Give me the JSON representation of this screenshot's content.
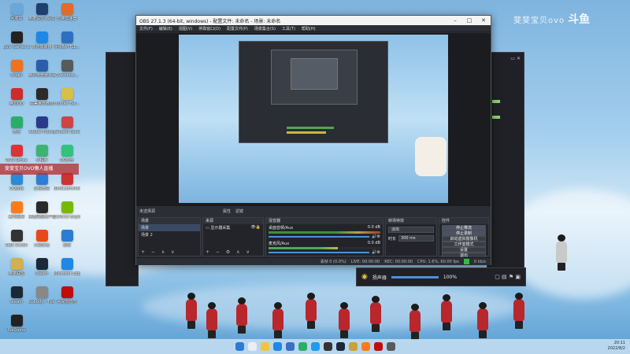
{
  "watermark": {
    "text1": "斐斐宝贝ovo",
    "text2": "斗鱼"
  },
  "live_tag": "斐斐宝贝OVO懒人直播",
  "desktop": {
    "icons": [
      {
        "label": "回收站",
        "color": "#6aa8d8"
      },
      {
        "label": "英雄联盟 WeGame版",
        "color": "#1f3f6f"
      },
      {
        "label": "雷神加速器",
        "color": "#e06b2b"
      },
      {
        "label": "Epic Games Launcher",
        "color": "#222"
      },
      {
        "label": "新增加速器",
        "color": "#1e88e5"
      },
      {
        "label": "网易BATTLE...",
        "color": "#2f6fbf"
      },
      {
        "label": "Origin",
        "color": "#f2711c"
      },
      {
        "label": "腾讯电竞赛大事件",
        "color": "#2b5dab"
      },
      {
        "label": "Overclock...",
        "color": "#5a5a5a"
      },
      {
        "label": "腾讯QQ",
        "color": "#d02b2b"
      },
      {
        "label": "完美世界竞技",
        "color": "#2a2a2a"
      },
      {
        "label": "Human Fall...",
        "color": "#d6c04a"
      },
      {
        "label": "微信",
        "color": "#2aae67"
      },
      {
        "label": "Adobe Photosho...",
        "color": "#2a3a8a"
      },
      {
        "label": "Tencent Games",
        "color": "#c44"
      },
      {
        "label": "WPS Office",
        "color": "#d33"
      },
      {
        "label": "小程序",
        "color": "#3cb371"
      },
      {
        "label": "QQ音乐",
        "color": "#31c27c"
      },
      {
        "label": "QQ游戏",
        "color": "#2b8ad8"
      },
      {
        "label": "企业微信",
        "color": "#2e7dd7"
      },
      {
        "label": "BootLauncher",
        "color": "#c33"
      },
      {
        "label": "腾讯视频",
        "color": "#ff7a1a"
      },
      {
        "label": "英雄联盟客户端",
        "color": "#2a2a2a"
      },
      {
        "label": "Geforce Experience",
        "color": "#76b900"
      },
      {
        "label": "OBS Studio",
        "color": "#333"
      },
      {
        "label": "火绒安全",
        "color": "#e64a19"
      },
      {
        "label": "迅雷",
        "color": "#2b7cd3"
      },
      {
        "label": "英雄联盟",
        "color": "#d4b04a"
      },
      {
        "label": "Steam",
        "color": "#1b2838"
      },
      {
        "label": "Microsoft Edge",
        "color": "#1e88e5"
      },
      {
        "label": "Steam",
        "color": "#1b2838"
      },
      {
        "label": "Nobody - The Turna...",
        "color": "#888"
      },
      {
        "label": "网易云音乐",
        "color": "#c20c0c"
      },
      {
        "label": "WeGame",
        "color": "#222"
      }
    ]
  },
  "obs": {
    "title": "OBS 27.1.3 (64-bit, windows) - 配置文件: 未命名 - 场景: 未命名",
    "menu": [
      "文件(F)",
      "编辑(E)",
      "视图(V)",
      "停靠窗口(D)",
      "配置文件(P)",
      "场景集合(S)",
      "工具(T)",
      "帮助(H)"
    ],
    "status_row": {
      "left": "未选择源",
      "props": "属性",
      "filters": "滤镜"
    },
    "docks": {
      "scenes": {
        "header": "场景",
        "items": [
          "场景",
          "场景 2"
        ],
        "selected": 0
      },
      "sources": {
        "header": "来源",
        "items": [
          "显示器采集"
        ]
      },
      "mixer": {
        "header": "混音器",
        "channels": [
          {
            "name": "桌面音频/Aux",
            "db": "0.0 dB"
          },
          {
            "name": "麦克风/Aux",
            "db": "0.0 dB"
          }
        ]
      },
      "transitions": {
        "header": "转场特效",
        "type": "淡出",
        "duration_label": "时长",
        "duration": "300 ms"
      },
      "controls": {
        "header": "控件",
        "buttons": [
          "停止推流",
          "停止录制",
          "启动虚拟摄像机",
          "工作室模式",
          "设置",
          "退出"
        ]
      }
    },
    "statusbar": {
      "dropped": "丢帧 0 (0.0%)",
      "live": "LIVE: 00:00:00",
      "rec": "REC: 00:00:00",
      "cpu": "CPU: 1.6%, 60.00 fps",
      "kbps": "0 kb/s",
      "status_color": "#2fbf3f"
    }
  },
  "speaker_bar": {
    "label": "扬声器",
    "volume": "100%"
  },
  "tray": {
    "time": "20:11",
    "date": "2022/8/2"
  },
  "taskbar": {
    "icons": [
      {
        "name": "windows",
        "color": "#2a7bd6"
      },
      {
        "name": "search",
        "color": "#e8eef4"
      },
      {
        "name": "explorer",
        "color": "#f5c33b"
      },
      {
        "name": "edge",
        "color": "#1e88e5"
      },
      {
        "name": "store",
        "color": "#3a6fc4"
      },
      {
        "name": "wechat",
        "color": "#2aae67"
      },
      {
        "name": "qq",
        "color": "#1e9cf0"
      },
      {
        "name": "obs",
        "color": "#333"
      },
      {
        "name": "steam",
        "color": "#1b2838"
      },
      {
        "name": "lol",
        "color": "#c9a23a"
      },
      {
        "name": "douyu",
        "color": "#ff7a1a"
      },
      {
        "name": "music",
        "color": "#c20c0c"
      },
      {
        "name": "app",
        "color": "#5a5a5a"
      }
    ]
  }
}
